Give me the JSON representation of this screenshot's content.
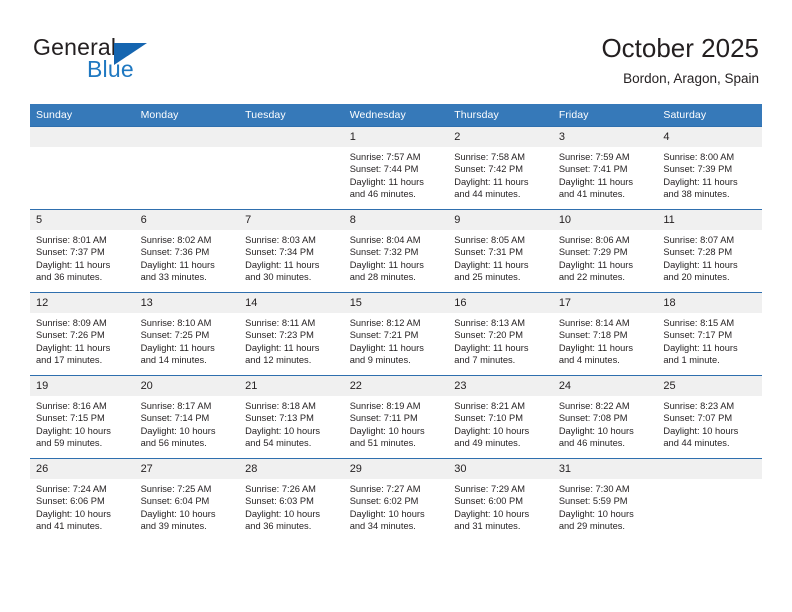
{
  "logo": {
    "word_one": "General",
    "word_two": "Blue",
    "triangle_color": "#1565b0",
    "blue_text_color": "#1f78c1"
  },
  "header": {
    "title": "October 2025",
    "subtitle": "Bordon, Aragon, Spain",
    "accent_color": "#3679b9",
    "row_border_color": "#2f6fae",
    "daynum_band_color": "#f0f0f0"
  },
  "weekdays": [
    "Sunday",
    "Monday",
    "Tuesday",
    "Wednesday",
    "Thursday",
    "Friday",
    "Saturday"
  ],
  "weeks": [
    [
      {
        "day": "",
        "sunrise": "",
        "sunset": "",
        "daylight_line1": "",
        "daylight_line2": "",
        "empty": true
      },
      {
        "day": "",
        "sunrise": "",
        "sunset": "",
        "daylight_line1": "",
        "daylight_line2": "",
        "empty": true
      },
      {
        "day": "",
        "sunrise": "",
        "sunset": "",
        "daylight_line1": "",
        "daylight_line2": "",
        "empty": true
      },
      {
        "day": "1",
        "sunrise": "Sunrise: 7:57 AM",
        "sunset": "Sunset: 7:44 PM",
        "daylight_line1": "Daylight: 11 hours",
        "daylight_line2": "and 46 minutes."
      },
      {
        "day": "2",
        "sunrise": "Sunrise: 7:58 AM",
        "sunset": "Sunset: 7:42 PM",
        "daylight_line1": "Daylight: 11 hours",
        "daylight_line2": "and 44 minutes."
      },
      {
        "day": "3",
        "sunrise": "Sunrise: 7:59 AM",
        "sunset": "Sunset: 7:41 PM",
        "daylight_line1": "Daylight: 11 hours",
        "daylight_line2": "and 41 minutes."
      },
      {
        "day": "4",
        "sunrise": "Sunrise: 8:00 AM",
        "sunset": "Sunset: 7:39 PM",
        "daylight_line1": "Daylight: 11 hours",
        "daylight_line2": "and 38 minutes."
      }
    ],
    [
      {
        "day": "5",
        "sunrise": "Sunrise: 8:01 AM",
        "sunset": "Sunset: 7:37 PM",
        "daylight_line1": "Daylight: 11 hours",
        "daylight_line2": "and 36 minutes."
      },
      {
        "day": "6",
        "sunrise": "Sunrise: 8:02 AM",
        "sunset": "Sunset: 7:36 PM",
        "daylight_line1": "Daylight: 11 hours",
        "daylight_line2": "and 33 minutes."
      },
      {
        "day": "7",
        "sunrise": "Sunrise: 8:03 AM",
        "sunset": "Sunset: 7:34 PM",
        "daylight_line1": "Daylight: 11 hours",
        "daylight_line2": "and 30 minutes."
      },
      {
        "day": "8",
        "sunrise": "Sunrise: 8:04 AM",
        "sunset": "Sunset: 7:32 PM",
        "daylight_line1": "Daylight: 11 hours",
        "daylight_line2": "and 28 minutes."
      },
      {
        "day": "9",
        "sunrise": "Sunrise: 8:05 AM",
        "sunset": "Sunset: 7:31 PM",
        "daylight_line1": "Daylight: 11 hours",
        "daylight_line2": "and 25 minutes."
      },
      {
        "day": "10",
        "sunrise": "Sunrise: 8:06 AM",
        "sunset": "Sunset: 7:29 PM",
        "daylight_line1": "Daylight: 11 hours",
        "daylight_line2": "and 22 minutes."
      },
      {
        "day": "11",
        "sunrise": "Sunrise: 8:07 AM",
        "sunset": "Sunset: 7:28 PM",
        "daylight_line1": "Daylight: 11 hours",
        "daylight_line2": "and 20 minutes."
      }
    ],
    [
      {
        "day": "12",
        "sunrise": "Sunrise: 8:09 AM",
        "sunset": "Sunset: 7:26 PM",
        "daylight_line1": "Daylight: 11 hours",
        "daylight_line2": "and 17 minutes."
      },
      {
        "day": "13",
        "sunrise": "Sunrise: 8:10 AM",
        "sunset": "Sunset: 7:25 PM",
        "daylight_line1": "Daylight: 11 hours",
        "daylight_line2": "and 14 minutes."
      },
      {
        "day": "14",
        "sunrise": "Sunrise: 8:11 AM",
        "sunset": "Sunset: 7:23 PM",
        "daylight_line1": "Daylight: 11 hours",
        "daylight_line2": "and 12 minutes."
      },
      {
        "day": "15",
        "sunrise": "Sunrise: 8:12 AM",
        "sunset": "Sunset: 7:21 PM",
        "daylight_line1": "Daylight: 11 hours",
        "daylight_line2": "and 9 minutes."
      },
      {
        "day": "16",
        "sunrise": "Sunrise: 8:13 AM",
        "sunset": "Sunset: 7:20 PM",
        "daylight_line1": "Daylight: 11 hours",
        "daylight_line2": "and 7 minutes."
      },
      {
        "day": "17",
        "sunrise": "Sunrise: 8:14 AM",
        "sunset": "Sunset: 7:18 PM",
        "daylight_line1": "Daylight: 11 hours",
        "daylight_line2": "and 4 minutes."
      },
      {
        "day": "18",
        "sunrise": "Sunrise: 8:15 AM",
        "sunset": "Sunset: 7:17 PM",
        "daylight_line1": "Daylight: 11 hours",
        "daylight_line2": "and 1 minute."
      }
    ],
    [
      {
        "day": "19",
        "sunrise": "Sunrise: 8:16 AM",
        "sunset": "Sunset: 7:15 PM",
        "daylight_line1": "Daylight: 10 hours",
        "daylight_line2": "and 59 minutes."
      },
      {
        "day": "20",
        "sunrise": "Sunrise: 8:17 AM",
        "sunset": "Sunset: 7:14 PM",
        "daylight_line1": "Daylight: 10 hours",
        "daylight_line2": "and 56 minutes."
      },
      {
        "day": "21",
        "sunrise": "Sunrise: 8:18 AM",
        "sunset": "Sunset: 7:13 PM",
        "daylight_line1": "Daylight: 10 hours",
        "daylight_line2": "and 54 minutes."
      },
      {
        "day": "22",
        "sunrise": "Sunrise: 8:19 AM",
        "sunset": "Sunset: 7:11 PM",
        "daylight_line1": "Daylight: 10 hours",
        "daylight_line2": "and 51 minutes."
      },
      {
        "day": "23",
        "sunrise": "Sunrise: 8:21 AM",
        "sunset": "Sunset: 7:10 PM",
        "daylight_line1": "Daylight: 10 hours",
        "daylight_line2": "and 49 minutes."
      },
      {
        "day": "24",
        "sunrise": "Sunrise: 8:22 AM",
        "sunset": "Sunset: 7:08 PM",
        "daylight_line1": "Daylight: 10 hours",
        "daylight_line2": "and 46 minutes."
      },
      {
        "day": "25",
        "sunrise": "Sunrise: 8:23 AM",
        "sunset": "Sunset: 7:07 PM",
        "daylight_line1": "Daylight: 10 hours",
        "daylight_line2": "and 44 minutes."
      }
    ],
    [
      {
        "day": "26",
        "sunrise": "Sunrise: 7:24 AM",
        "sunset": "Sunset: 6:06 PM",
        "daylight_line1": "Daylight: 10 hours",
        "daylight_line2": "and 41 minutes."
      },
      {
        "day": "27",
        "sunrise": "Sunrise: 7:25 AM",
        "sunset": "Sunset: 6:04 PM",
        "daylight_line1": "Daylight: 10 hours",
        "daylight_line2": "and 39 minutes."
      },
      {
        "day": "28",
        "sunrise": "Sunrise: 7:26 AM",
        "sunset": "Sunset: 6:03 PM",
        "daylight_line1": "Daylight: 10 hours",
        "daylight_line2": "and 36 minutes."
      },
      {
        "day": "29",
        "sunrise": "Sunrise: 7:27 AM",
        "sunset": "Sunset: 6:02 PM",
        "daylight_line1": "Daylight: 10 hours",
        "daylight_line2": "and 34 minutes."
      },
      {
        "day": "30",
        "sunrise": "Sunrise: 7:29 AM",
        "sunset": "Sunset: 6:00 PM",
        "daylight_line1": "Daylight: 10 hours",
        "daylight_line2": "and 31 minutes."
      },
      {
        "day": "31",
        "sunrise": "Sunrise: 7:30 AM",
        "sunset": "Sunset: 5:59 PM",
        "daylight_line1": "Daylight: 10 hours",
        "daylight_line2": "and 29 minutes."
      },
      {
        "day": "",
        "sunrise": "",
        "sunset": "",
        "daylight_line1": "",
        "daylight_line2": "",
        "empty": true
      }
    ]
  ]
}
